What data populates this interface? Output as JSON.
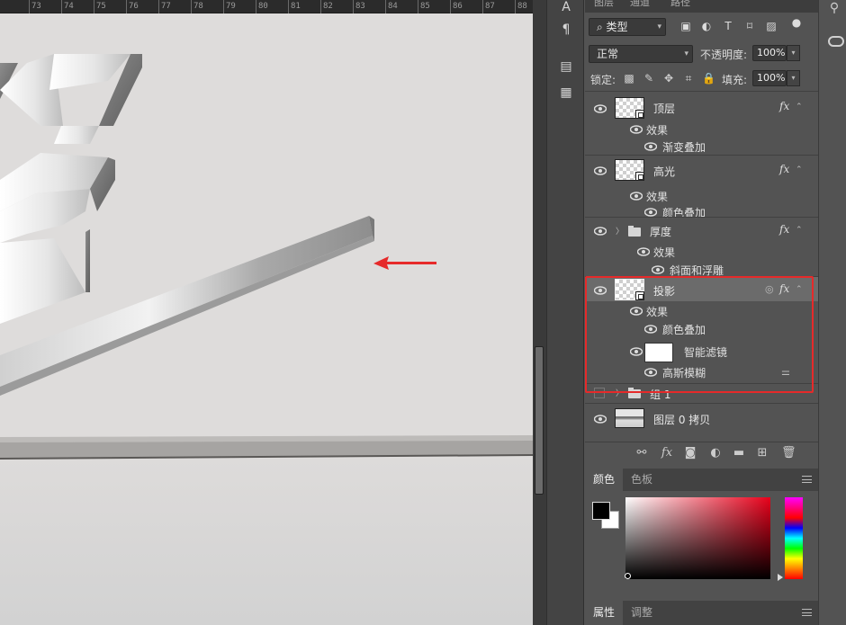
{
  "ruler": {
    "labels": [
      "73",
      "74",
      "75",
      "76",
      "77",
      "78",
      "79",
      "80",
      "81",
      "82",
      "83",
      "84",
      "85",
      "86",
      "87",
      "88"
    ]
  },
  "tools_strip": {
    "icons": [
      "character-icon",
      "paragraph-icon",
      "properties-icon",
      "notes-icon"
    ]
  },
  "panel_tabs": {
    "tab1": "图层",
    "tab2": "通道",
    "tab3": "路径"
  },
  "filter": {
    "kind_label": "类型",
    "chev": "⌵"
  },
  "blend": {
    "mode": "正常",
    "opacity_label": "不透明度:",
    "opacity_value": "100%",
    "lock_label": "锁定:",
    "fill_label": "填充:",
    "fill_value": "100%"
  },
  "layers": {
    "top": {
      "name": "顶层",
      "effects": "效果",
      "effect1": "渐变叠加",
      "fx": "fx"
    },
    "highlight": {
      "name": "高光",
      "effects": "效果",
      "effect1": "颜色叠加",
      "fx": "fx"
    },
    "thickness": {
      "name": "厚度",
      "effects": "效果",
      "effect1": "斜面和浮雕",
      "fx": "fx"
    },
    "shadow": {
      "name": "投影",
      "effects": "效果",
      "effect1": "颜色叠加",
      "smart_filters": "智能滤镜",
      "filter1": "高斯模糊",
      "fx": "fx"
    },
    "group1": {
      "name": "组 1"
    },
    "copy": {
      "name": "图层 0 拷贝"
    }
  },
  "color_panel": {
    "tab_color": "颜色",
    "tab_swatches": "色板",
    "fg": "#000000",
    "bg": "#ffffff"
  },
  "properties_panel": {
    "tab_properties": "属性",
    "tab_adjust": "调整"
  },
  "accent": {
    "annotation_red": "#e62a2a"
  }
}
